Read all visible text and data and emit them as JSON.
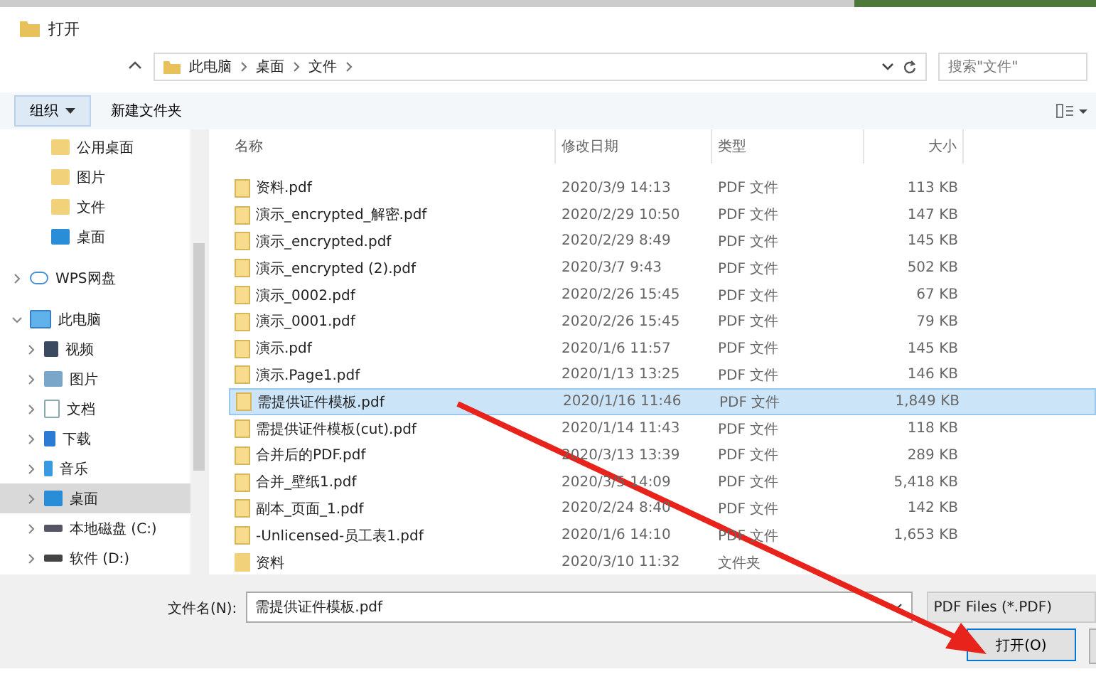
{
  "window": {
    "title": "打开"
  },
  "address_bar": {
    "path": [
      "此电脑",
      "桌面",
      "文件"
    ]
  },
  "search": {
    "placeholder": "搜索\"文件\""
  },
  "toolbar": {
    "organize": "组织",
    "new_folder": "新建文件夹"
  },
  "sidebar": {
    "top_items": [
      {
        "label": "公用桌面",
        "kind": "folder",
        "selected": false
      },
      {
        "label": "图片",
        "kind": "folder",
        "selected": false
      },
      {
        "label": "文件",
        "kind": "folder",
        "selected": false
      },
      {
        "label": "桌面",
        "kind": "desktop",
        "selected": false
      }
    ],
    "tree": [
      {
        "label": "WPS网盘",
        "kind": "cloud",
        "expanded": false,
        "selected": false
      },
      {
        "label": "此电脑",
        "kind": "pc",
        "expanded": true,
        "selected": false,
        "children": [
          {
            "label": "视频",
            "kind": "video",
            "expanded": false,
            "selected": false
          },
          {
            "label": "图片",
            "kind": "pictures",
            "expanded": false,
            "selected": false
          },
          {
            "label": "文档",
            "kind": "docs",
            "expanded": false,
            "selected": false
          },
          {
            "label": "下载",
            "kind": "download",
            "expanded": false,
            "selected": false
          },
          {
            "label": "音乐",
            "kind": "music",
            "expanded": false,
            "selected": false
          },
          {
            "label": "桌面",
            "kind": "desktop",
            "expanded": false,
            "selected": true
          },
          {
            "label": "本地磁盘 (C:)",
            "kind": "system-drive",
            "expanded": false,
            "selected": false
          },
          {
            "label": "软件 (D:)",
            "kind": "drive",
            "expanded": false,
            "selected": false
          }
        ]
      }
    ]
  },
  "table": {
    "columns": [
      "名称",
      "修改日期",
      "类型",
      "大小"
    ],
    "rows": [
      {
        "kind": "pdf",
        "name": "资料.pdf",
        "date": "2020/3/9 14:13",
        "type": "PDF 文件",
        "size": "113 KB",
        "selected": false
      },
      {
        "kind": "pdf",
        "name": "演示_encrypted_解密.pdf",
        "date": "2020/2/29 10:50",
        "type": "PDF 文件",
        "size": "147 KB",
        "selected": false
      },
      {
        "kind": "pdf",
        "name": "演示_encrypted.pdf",
        "date": "2020/2/29 8:49",
        "type": "PDF 文件",
        "size": "145 KB",
        "selected": false
      },
      {
        "kind": "pdf",
        "name": "演示_encrypted (2).pdf",
        "date": "2020/3/7 9:43",
        "type": "PDF 文件",
        "size": "502 KB",
        "selected": false
      },
      {
        "kind": "pdf",
        "name": "演示_0002.pdf",
        "date": "2020/2/26 15:45",
        "type": "PDF 文件",
        "size": "67 KB",
        "selected": false
      },
      {
        "kind": "pdf",
        "name": "演示_0001.pdf",
        "date": "2020/2/26 15:45",
        "type": "PDF 文件",
        "size": "79 KB",
        "selected": false
      },
      {
        "kind": "pdf",
        "name": "演示.pdf",
        "date": "2020/1/6 11:57",
        "type": "PDF 文件",
        "size": "145 KB",
        "selected": false
      },
      {
        "kind": "pdf",
        "name": "演示.Page1.pdf",
        "date": "2020/1/13 13:25",
        "type": "PDF 文件",
        "size": "146 KB",
        "selected": false
      },
      {
        "kind": "pdf",
        "name": "需提供证件模板.pdf",
        "date": "2020/1/16 11:46",
        "type": "PDF 文件",
        "size": "1,849 KB",
        "selected": true
      },
      {
        "kind": "pdf",
        "name": "需提供证件模板(cut).pdf",
        "date": "2020/1/14 11:43",
        "type": "PDF 文件",
        "size": "118 KB",
        "selected": false
      },
      {
        "kind": "pdf",
        "name": "合并后的PDF.pdf",
        "date": "2020/3/13 13:39",
        "type": "PDF 文件",
        "size": "289 KB",
        "selected": false
      },
      {
        "kind": "pdf",
        "name": "合并_壁纸1.pdf",
        "date": "2020/3/5 14:09",
        "type": "PDF 文件",
        "size": "5,418 KB",
        "selected": false
      },
      {
        "kind": "pdf",
        "name": "副本_页面_1.pdf",
        "date": "2020/2/24 8:40",
        "type": "PDF 文件",
        "size": "142 KB",
        "selected": false
      },
      {
        "kind": "pdf",
        "name": "-Unlicensed-员工表1.pdf",
        "date": "2020/1/6 14:10",
        "type": "PDF 文件",
        "size": "1,653 KB",
        "selected": false
      },
      {
        "kind": "folder",
        "name": "资料",
        "date": "2020/3/10 11:32",
        "type": "文件夹",
        "selected": false
      }
    ]
  },
  "footer": {
    "file_name_label": "文件名(N):",
    "file_name_value": "需提供证件模板.pdf",
    "filter": "PDF Files (*.PDF)",
    "open_button": "打开(O)"
  }
}
